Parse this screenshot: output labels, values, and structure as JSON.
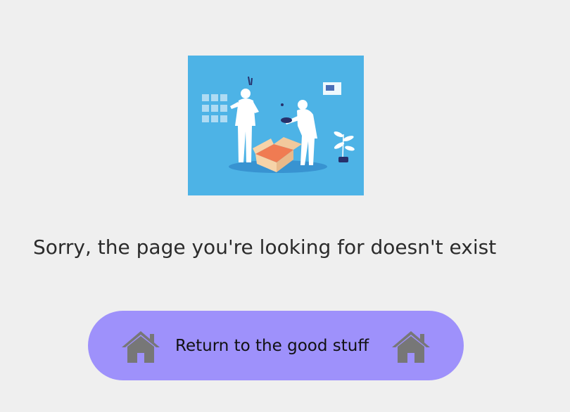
{
  "illustration": {
    "icon": "not-found-illustration",
    "background_color": "#4db3e6"
  },
  "message": {
    "text": "Sorry, the page you're looking for doesn't exist"
  },
  "return_button": {
    "label": "Return to the good stuff",
    "background_color": "#9e91fb",
    "left_icon": "home-icon",
    "right_icon": "home-icon"
  }
}
